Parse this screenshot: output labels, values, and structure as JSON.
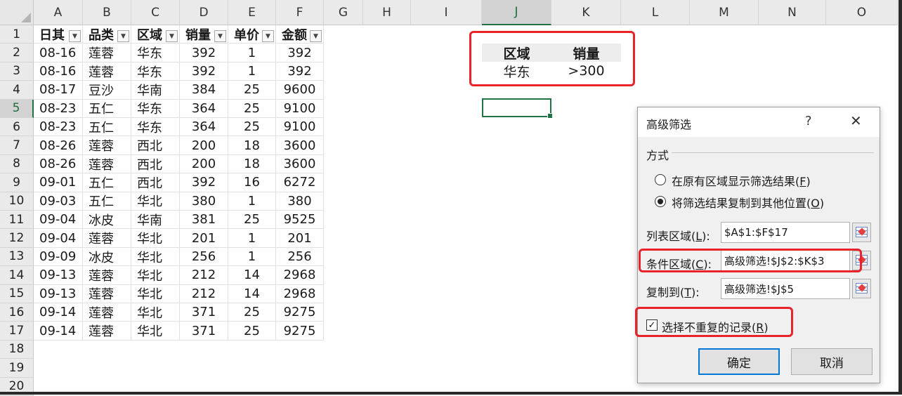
{
  "columns": [
    "A",
    "B",
    "C",
    "D",
    "E",
    "F",
    "G",
    "H",
    "I",
    "J",
    "K",
    "L",
    "M",
    "N",
    "O"
  ],
  "selected_column": "J",
  "rows": [
    "1",
    "2",
    "3",
    "4",
    "5",
    "6",
    "7",
    "8",
    "9",
    "10",
    "11",
    "12",
    "13",
    "14",
    "15",
    "16",
    "17",
    "18",
    "19",
    "20"
  ],
  "selected_row": "5",
  "table": {
    "headers": [
      "日其",
      "品类",
      "区域",
      "销量",
      "单价",
      "金额"
    ],
    "data": [
      [
        "08-16",
        "莲蓉",
        "华东",
        "392",
        "1",
        "392"
      ],
      [
        "08-16",
        "莲蓉",
        "华东",
        "392",
        "1",
        "392"
      ],
      [
        "08-17",
        "豆沙",
        "华南",
        "384",
        "25",
        "9600"
      ],
      [
        "08-23",
        "五仁",
        "华东",
        "364",
        "25",
        "9100"
      ],
      [
        "08-23",
        "五仁",
        "华东",
        "364",
        "25",
        "9100"
      ],
      [
        "08-26",
        "莲蓉",
        "西北",
        "200",
        "18",
        "3600"
      ],
      [
        "08-26",
        "莲蓉",
        "西北",
        "200",
        "18",
        "3600"
      ],
      [
        "09-01",
        "五仁",
        "西北",
        "392",
        "16",
        "6272"
      ],
      [
        "09-03",
        "五仁",
        "华北",
        "380",
        "1",
        "380"
      ],
      [
        "09-04",
        "冰皮",
        "华南",
        "381",
        "25",
        "9525"
      ],
      [
        "09-04",
        "莲蓉",
        "华北",
        "201",
        "1",
        "201"
      ],
      [
        "09-09",
        "冰皮",
        "华北",
        "256",
        "1",
        "256"
      ],
      [
        "09-13",
        "莲蓉",
        "华北",
        "212",
        "14",
        "2968"
      ],
      [
        "09-13",
        "莲蓉",
        "华北",
        "212",
        "14",
        "2968"
      ],
      [
        "09-14",
        "莲蓉",
        "华北",
        "371",
        "25",
        "9275"
      ],
      [
        "09-14",
        "莲蓉",
        "华北",
        "371",
        "25",
        "9275"
      ]
    ]
  },
  "criteria": {
    "headers": [
      "区域",
      "销量"
    ],
    "values": [
      "华东",
      ">300"
    ]
  },
  "dialog": {
    "title": "高级筛选",
    "help": "?",
    "close": "✕",
    "group_label": "方式",
    "radio1_pre": "在原有区域显示筛选结果(",
    "radio1_key": "F",
    "radio1_post": ")",
    "radio2_pre": "将筛选结果复制到其他位置(",
    "radio2_key": "O",
    "radio2_post": ")",
    "list_label_pre": "列表区域(",
    "list_label_key": "L",
    "list_label_post": "):",
    "list_value": "$A$1:$F$17",
    "crit_label_pre": "条件区域(",
    "crit_label_key": "C",
    "crit_label_post": "):",
    "crit_value": "高级筛选!$J$2:$K$3",
    "copy_label_pre": "复制到(",
    "copy_label_key": "T",
    "copy_label_post": "):",
    "copy_value": "高级筛选!$J$5",
    "unique_pre": "选择不重复的记录(",
    "unique_key": "R",
    "unique_post": ")",
    "unique_checked": true,
    "ok": "确定",
    "cancel": "取消"
  },
  "colors": {
    "highlight": "#e8232a",
    "excel_green": "#217346",
    "default_button_border": "#0078d7"
  }
}
